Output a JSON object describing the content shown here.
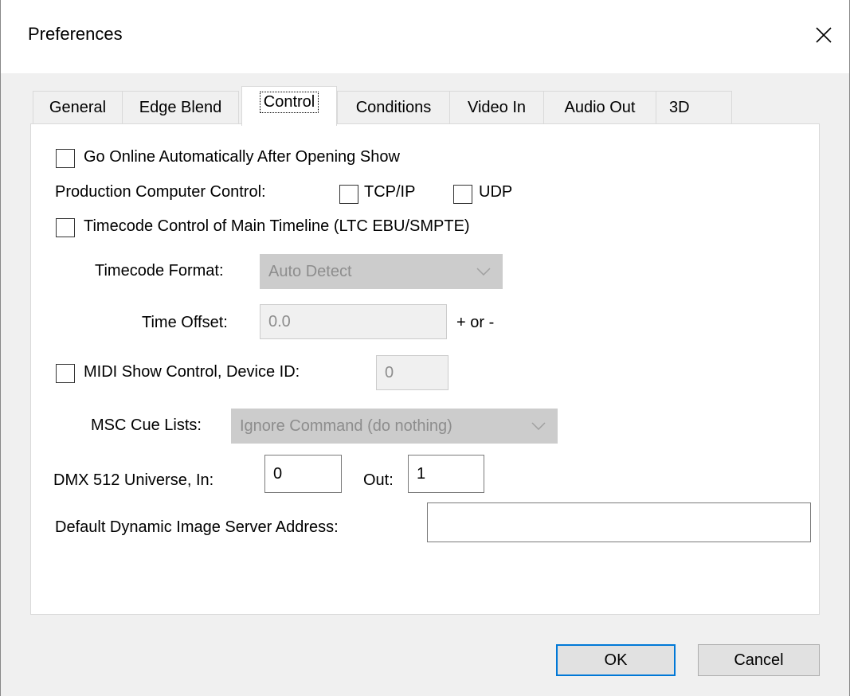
{
  "window": {
    "title": "Preferences"
  },
  "tabs": [
    {
      "label": "General"
    },
    {
      "label": "Edge Blend"
    },
    {
      "label": "Control"
    },
    {
      "label": "Conditions"
    },
    {
      "label": "Video In"
    },
    {
      "label": "Audio Out"
    },
    {
      "label": "3D"
    }
  ],
  "control": {
    "go_online": {
      "label": "Go Online Automatically After Opening Show",
      "checked": false
    },
    "production_control": {
      "label": "Production Computer Control:",
      "tcp_label": "TCP/IP",
      "tcp_checked": false,
      "udp_label": "UDP",
      "udp_checked": false
    },
    "timecode_control": {
      "label": "Timecode Control of Main Timeline (LTC EBU/SMPTE)",
      "checked": false
    },
    "timecode_format": {
      "label": "Timecode Format:",
      "value": "Auto Detect"
    },
    "time_offset": {
      "label": "Time Offset:",
      "value": "0.0",
      "suffix": "+ or -"
    },
    "midi": {
      "label": "MIDI Show Control, Device ID:",
      "device_id": "0",
      "checked": false
    },
    "msc_cue_lists": {
      "label": "MSC Cue Lists:",
      "value": "Ignore Command (do nothing)"
    },
    "dmx": {
      "label": "DMX 512 Universe, In:",
      "in_value": "0",
      "out_label": "Out:",
      "out_value": "1"
    },
    "image_server": {
      "label": "Default Dynamic Image Server Address:",
      "value": ""
    }
  },
  "buttons": {
    "ok": "OK",
    "cancel": "Cancel"
  },
  "icons": {
    "close": "close-icon",
    "chevron": "chevron-down-icon"
  }
}
